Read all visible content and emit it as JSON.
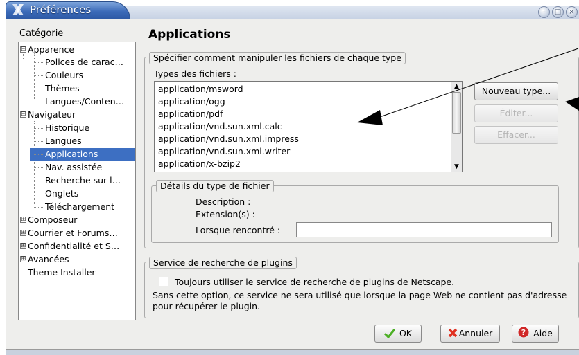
{
  "window": {
    "title": "Préférences",
    "icon": "x-logo-icon",
    "controls": [
      "minimize-icon",
      "maximize-icon",
      "close-icon"
    ]
  },
  "sidebar": {
    "heading": "Catégorie",
    "items": [
      {
        "label": "Apparence",
        "expander": "⊟"
      },
      {
        "label": "Polices de carac…"
      },
      {
        "label": "Couleurs"
      },
      {
        "label": "Thèmes"
      },
      {
        "label": "Langues/Conten…"
      },
      {
        "label": "Navigateur",
        "expander": "⊟"
      },
      {
        "label": "Historique"
      },
      {
        "label": "Langues"
      },
      {
        "label": "Applications",
        "selected": true
      },
      {
        "label": "Nav. assistée"
      },
      {
        "label": "Recherche sur l…"
      },
      {
        "label": "Onglets"
      },
      {
        "label": "Téléchargement"
      },
      {
        "label": "Composeur",
        "expander": "⊞"
      },
      {
        "label": "Courrier et Forums…",
        "expander": "⊞"
      },
      {
        "label": "Confidentialité et S…",
        "expander": "⊞"
      },
      {
        "label": "Avancées",
        "expander": "⊞"
      },
      {
        "label": "Theme Installer"
      }
    ]
  },
  "main": {
    "title": "Applications",
    "file_types_group": {
      "legend": "Spécifier comment manipuler les fichiers de chaque type",
      "list_label": "Types des fichiers :",
      "items": [
        "application/msword",
        "application/ogg",
        "application/pdf",
        "application/vnd.sun.xml.calc",
        "application/vnd.sun.xml.impress",
        "application/vnd.sun.xml.writer",
        "application/x-bzip2"
      ],
      "buttons": {
        "new_type": "Nouveau type...",
        "edit": "Éditer...",
        "delete": "Effacer..."
      }
    },
    "details_group": {
      "legend": "Détails du type de fichier",
      "description_label": "Description :",
      "extension_label": "Extension(s) :",
      "when_encountered_label": "Lorsque rencontré :",
      "when_encountered_value": ""
    },
    "plugin_group": {
      "legend": "Service de recherche de plugins",
      "checkbox_label": "Toujours utiliser le service de recherche de plugins de Netscape.",
      "checkbox_checked": false,
      "note": "Sans cette option, ce service ne sera utilisé que lorsque la page Web ne contient pas d'adresse pour récupérer le plugin."
    }
  },
  "footer": {
    "ok": "OK",
    "cancel": "Annuler",
    "help": "Aide"
  },
  "colors": {
    "selection": "#3d6fc2",
    "title_bar": "#3b6ab8",
    "ok_icon": "#4caf24",
    "cancel_icon": "#e03020",
    "help_icon": "#d02828"
  }
}
